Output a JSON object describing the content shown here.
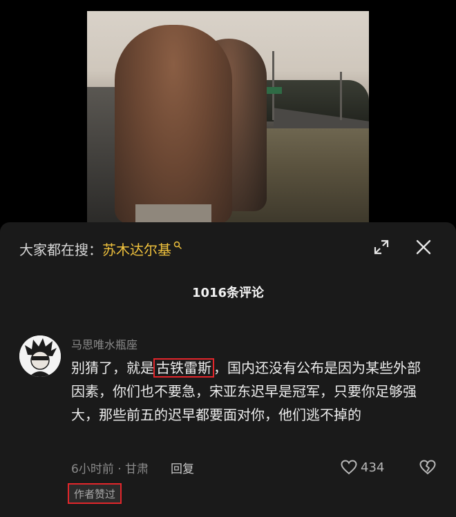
{
  "search": {
    "prefix": "大家都在搜：",
    "term": "苏木达尔基"
  },
  "comments_header": {
    "count_label": "1016条评论"
  },
  "comment": {
    "username": "马思唯水瓶座",
    "text_before": "别猜了，就是",
    "text_highlight": "古铁雷斯",
    "text_after": "，国内还没有公布是因为某些外部因素，你们也不要急，宋亚东迟早是冠军，只要你足够强大，那些前五的迟早都要面对你，他们逃不掉的",
    "time_location": "6小时前 · 甘肃",
    "reply_label": "回复",
    "like_count": "434",
    "author_liked_label": "作者赞过"
  },
  "colors": {
    "accent_search": "#f0c23d",
    "highlight_border": "#e3262b",
    "sheet_background": "#1a1a1a"
  },
  "icons": {
    "search": "search-icon",
    "expand": "expand-icon",
    "close": "close-icon",
    "like": "heart-icon",
    "dislike": "broken-heart-icon"
  }
}
